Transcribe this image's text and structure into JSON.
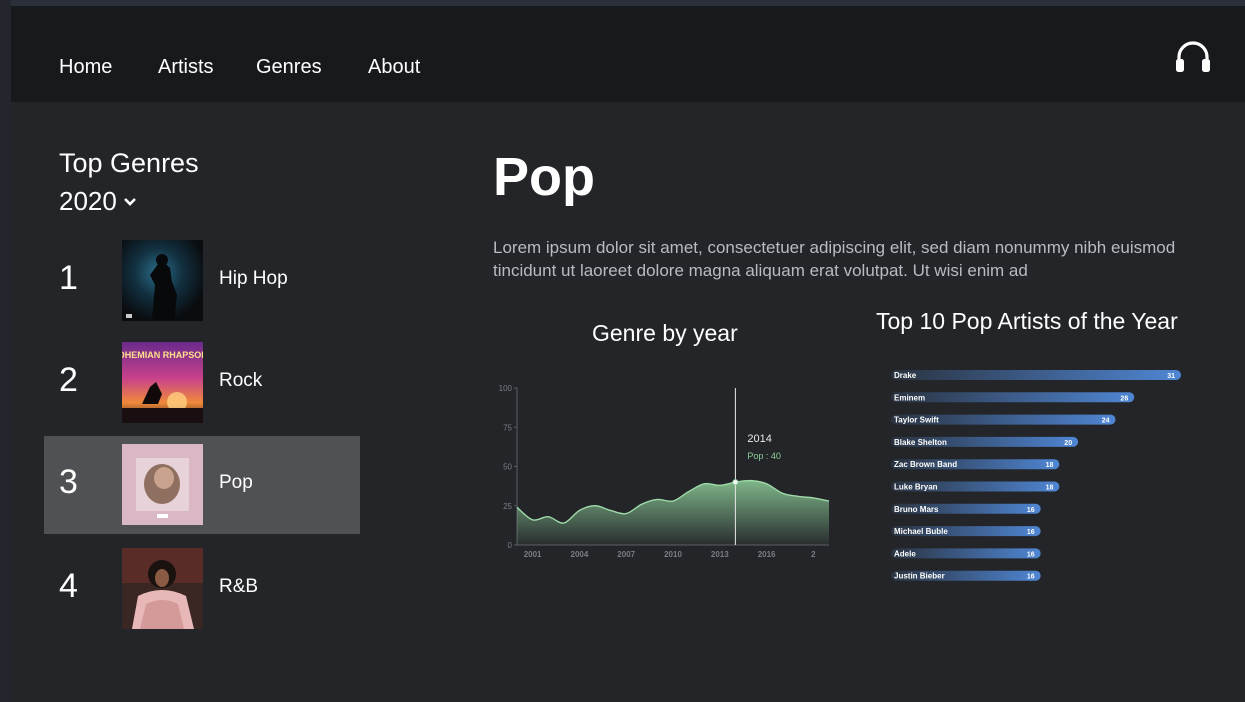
{
  "nav": {
    "items": [
      "Home",
      "Artists",
      "Genres",
      "About"
    ]
  },
  "icons": {
    "brand": "headphones-icon",
    "year_dropdown": "chevron-down-icon"
  },
  "sidebar": {
    "title": "Top Genres",
    "year": "2020",
    "genres": [
      {
        "rank": "1",
        "name": "Hip Hop",
        "cover_text": ""
      },
      {
        "rank": "2",
        "name": "Rock",
        "cover_text": "BOHEMIAN RHAPSODY"
      },
      {
        "rank": "3",
        "name": "Pop",
        "cover_text": ""
      },
      {
        "rank": "4",
        "name": "R&B",
        "cover_text": ""
      }
    ],
    "selected_index": 2
  },
  "main": {
    "title": "Pop",
    "description": "Lorem ipsum dolor sit amet, consectetuer adipiscing elit, sed diam nonummy nibh eu­ismod tincidunt ut laoreet dolore magna aliquam erat volutpat. Ut wisi enim ad"
  },
  "colors": {
    "area_fill": "#8fcf9a",
    "area_line": "#9ed9a8",
    "bar_start": "#2a3340",
    "bar_end": "#4f86d4",
    "selected_bg": "#505154",
    "tooltip_value": "#8fcf9a"
  },
  "chart_data": [
    {
      "type": "area",
      "title": "Genre by year",
      "x": [
        2000,
        2001,
        2002,
        2003,
        2004,
        2005,
        2006,
        2007,
        2008,
        2009,
        2010,
        2011,
        2012,
        2013,
        2014,
        2015,
        2016,
        2017,
        2018,
        2019,
        2020
      ],
      "series": [
        {
          "name": "Pop",
          "values": [
            24,
            16,
            18,
            14,
            22,
            25,
            22,
            20,
            26,
            29,
            28,
            34,
            39,
            38,
            40,
            41,
            39,
            33,
            31,
            30,
            28
          ]
        }
      ],
      "xticks": [
        "2001",
        "2004",
        "2007",
        "2010",
        "2013",
        "2016",
        "2"
      ],
      "yticks": [
        "100",
        "75",
        "50",
        "25",
        "0"
      ],
      "ylim": [
        0,
        100
      ],
      "tooltip": {
        "x": 2014,
        "title": "2014",
        "label": "Pop : 40"
      }
    },
    {
      "type": "bar",
      "title": "Top 10 Pop Artists of the Year",
      "categories": [
        "Drake",
        "Eminem",
        "Taylor Swift",
        "Blake Shelton",
        "Zac Brown Band",
        "Luke Bryan",
        "Bruno Mars",
        "Michael Buble",
        "Adele",
        "Justin Bieber"
      ],
      "values": [
        31,
        26,
        24,
        20,
        18,
        18,
        16,
        16,
        16,
        16
      ],
      "orientation": "horizontal"
    }
  ]
}
